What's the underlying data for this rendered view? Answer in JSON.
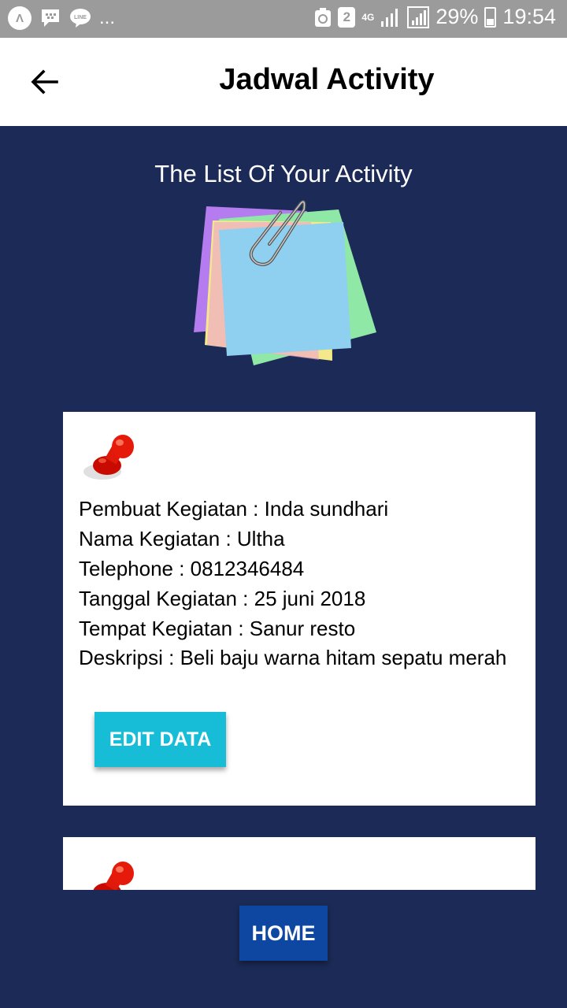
{
  "status_bar": {
    "left_icons": [
      "android-auto-icon",
      "bbm-icon",
      "line-icon"
    ],
    "line_label": "LINE",
    "overflow": "...",
    "sim_badge": "2",
    "network": "4G",
    "battery": "29%",
    "time": "19:54"
  },
  "app_bar": {
    "back_icon": "arrow-left-icon",
    "title": "Jadwal Activity"
  },
  "main": {
    "list_title": "The List Of Your Activity",
    "illustration": "sticky-notes-paperclip"
  },
  "cards": [
    {
      "pin_icon": "red-pushpin-icon",
      "pembuat_label": "Pembuat Kegiatan : Inda sundhari",
      "nama_label": "Nama Kegiatan : Ultha",
      "telephone_label": "Telephone : 0812346484",
      "tanggal_label": "Tanggal Kegiatan : 25 juni 2018",
      "tempat_label": "Tempat Kegiatan : Sanur resto",
      "deskripsi_label": "Deskripsi :  Beli baju warna hitam sepatu merah",
      "edit_label": "EDIT DATA"
    },
    {
      "pin_icon": "red-pushpin-icon"
    }
  ],
  "footer": {
    "home_label": "HOME"
  },
  "colors": {
    "background": "#1b2a56",
    "edit_button": "#17bcd6",
    "home_button": "#0d47a1",
    "status_bar": "#9b9b9b"
  }
}
